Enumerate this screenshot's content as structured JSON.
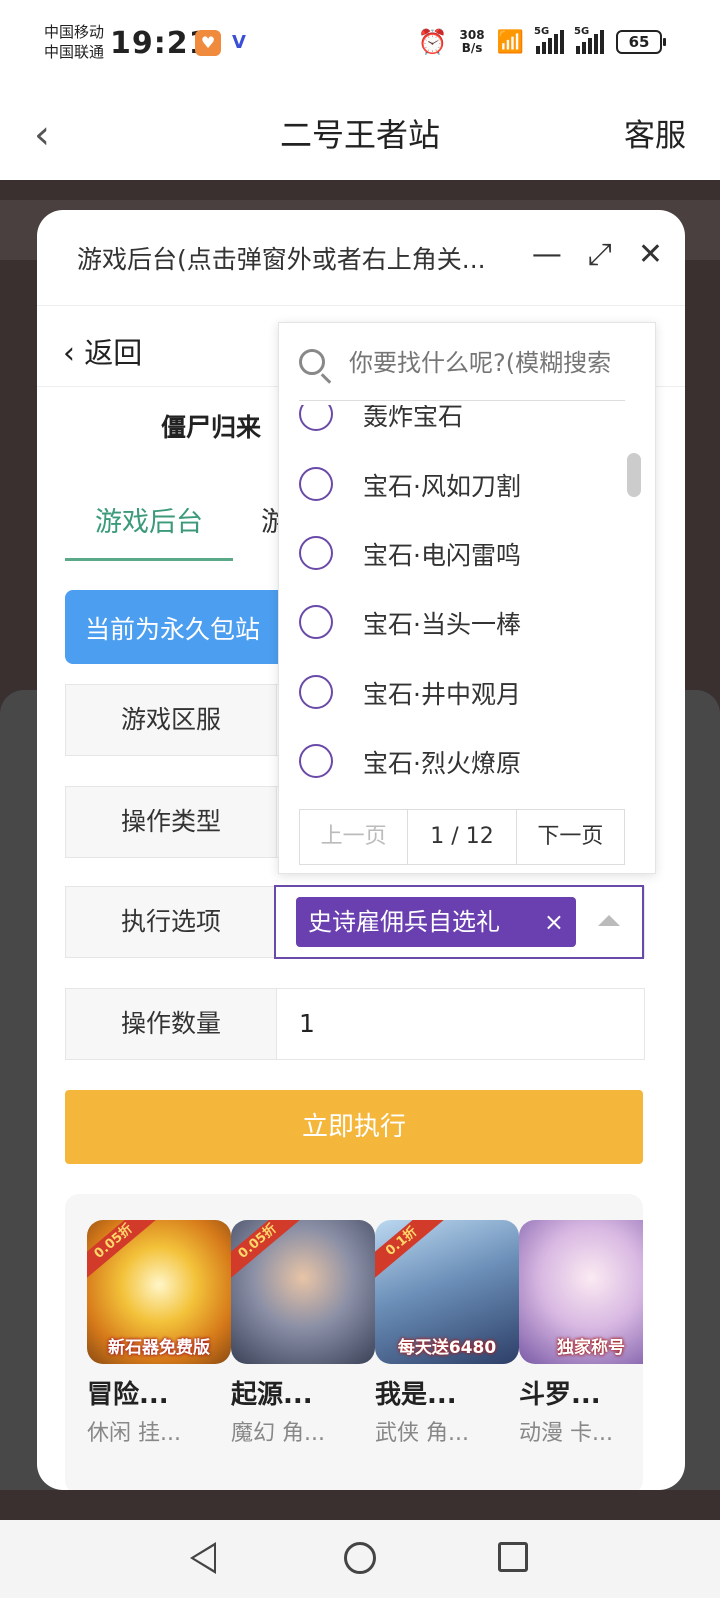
{
  "status": {
    "carrier1": "中国移动",
    "carrier2": "中国联通",
    "time": "19:21",
    "speed_value": "308",
    "speed_unit": "B/s",
    "battery": "65"
  },
  "header": {
    "title": "二号王者站",
    "service": "客服"
  },
  "modal": {
    "title": "游戏后台(点击弹窗外或者右上角关...",
    "back_label": "返回",
    "game_name": "僵尸归来",
    "tabs": [
      "游戏后台",
      "游"
    ],
    "notice": "当前为永久包站",
    "fields": {
      "server_label": "游戏区服",
      "type_label": "操作类型",
      "option_label": "执行选项",
      "option_selected": "史诗雇佣兵自选礼",
      "qty_label": "操作数量",
      "qty_value": "1"
    },
    "exec_button": "立即执行"
  },
  "dropdown": {
    "search_placeholder": "你要找什么呢?(模糊搜索",
    "options": [
      "轰炸宝石",
      "宝石·风如刀割",
      "宝石·电闪雷鸣",
      "宝石·当头一棒",
      "宝石·井中观月",
      "宝石·烈火燎原"
    ],
    "pager": {
      "prev": "上一页",
      "page": "1 / 12",
      "next": "下一页"
    }
  },
  "games": [
    {
      "name": "冒险...",
      "tags": "休闲 挂...",
      "discount": "0.05折",
      "caption": "新石器免费版"
    },
    {
      "name": "起源...",
      "tags": "魔幻 角...",
      "discount": "0.05折",
      "caption": ""
    },
    {
      "name": "我是...",
      "tags": "武侠 角...",
      "discount": "0.1折",
      "caption": "每天送6480"
    },
    {
      "name": "斗罗...",
      "tags": "动漫 卡...",
      "discount": "",
      "caption": "独家称号"
    }
  ]
}
